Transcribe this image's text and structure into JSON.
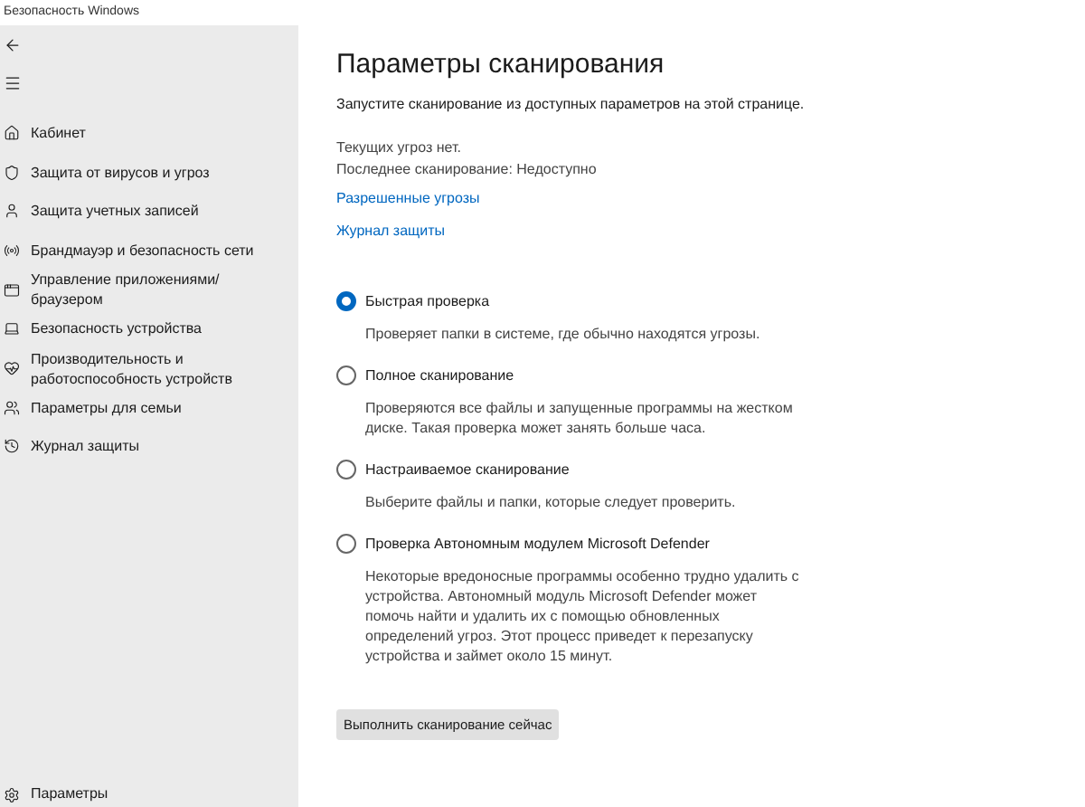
{
  "window": {
    "title": "Безопасность Windows"
  },
  "sidebar": {
    "items": [
      {
        "label": "Кабинет",
        "kind": "home"
      },
      {
        "label": "Защита от вирусов и угроз",
        "kind": "shield"
      },
      {
        "label": "Защита учетных записей",
        "kind": "person"
      },
      {
        "label": "Брандмауэр и безопасность сети",
        "kind": "network"
      },
      {
        "label": "Управление приложениями/браузером",
        "kind": "app"
      },
      {
        "label": "Безопасность устройства",
        "kind": "device"
      },
      {
        "label": "Производительность и работоспособность устройств",
        "kind": "health"
      },
      {
        "label": "Параметры для семьи",
        "kind": "family"
      },
      {
        "label": "Журнал защиты",
        "kind": "history"
      }
    ],
    "settings": "Параметры"
  },
  "main": {
    "title": "Параметры сканирования",
    "subtitle": "Запустите сканирование из доступных параметров на этой странице.",
    "status": [
      "Текущих угроз нет.",
      "Последнее сканирование: Недоступно"
    ],
    "links": [
      "Разрешенные угрозы",
      "Журнал защиты"
    ],
    "options": [
      {
        "label": "Быстрая проверка",
        "selected": true,
        "description": "Проверяет папки в системе, где обычно находятся угрозы."
      },
      {
        "label": "Полное сканирование",
        "selected": false,
        "description": "Проверяются все файлы и запущенные программы на жестком диске. Такая проверка может занять больше часа."
      },
      {
        "label": "Настраиваемое сканирование",
        "selected": false,
        "description": "Выберите файлы и папки, которые следует проверить."
      },
      {
        "label": "Проверка Автономным модулем Microsoft Defender",
        "selected": false,
        "description": "Некоторые вредоносные программы особенно трудно удалить с устройства. Автономный модуль Microsoft Defender может помочь найти и удалить их с помощью обновленных определений угроз. Этот процесс приведет к перезапуску устройства и займет около 15 минут."
      }
    ],
    "button": "Выполнить сканирование сейчас"
  }
}
